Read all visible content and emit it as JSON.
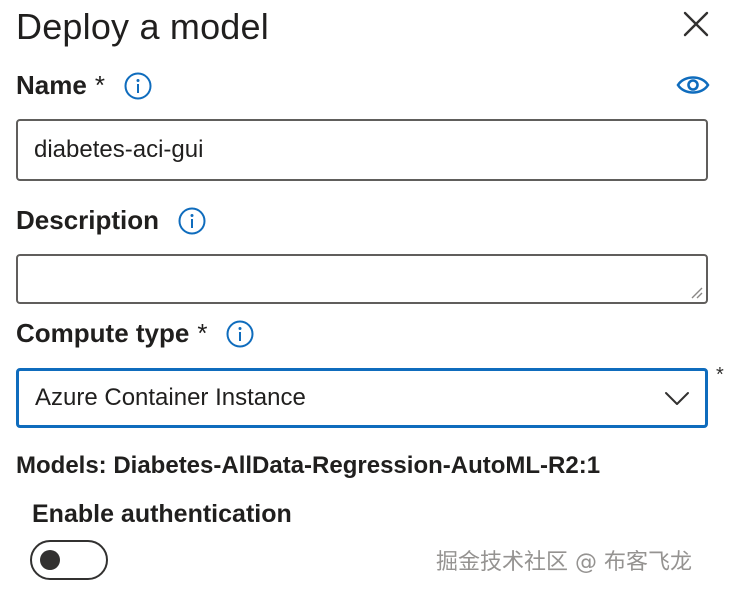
{
  "dialog": {
    "title": "Deploy a model"
  },
  "fields": {
    "name": {
      "label": "Name",
      "required_mark": "*",
      "value": "diabetes-aci-gui"
    },
    "description": {
      "label": "Description",
      "value": ""
    },
    "compute_type": {
      "label": "Compute type",
      "required_mark": "*",
      "selected": "Azure Container Instance",
      "outer_required_mark": "*"
    }
  },
  "models": {
    "text": "Models: Diabetes-AllData-Regression-AutoML-R2:1"
  },
  "authentication": {
    "label": "Enable authentication",
    "enabled": false
  },
  "watermark": {
    "text": "掘金技术社区 @ 布客飞龙"
  },
  "icons": {
    "close": "close-icon",
    "info": "info-icon",
    "eye": "eye-icon",
    "chevron": "chevron-down-icon"
  },
  "colors": {
    "focus_border": "#0f6cbd",
    "info_blue": "#0f6cbd",
    "text": "#201f1e",
    "field_border": "#605e5c"
  }
}
